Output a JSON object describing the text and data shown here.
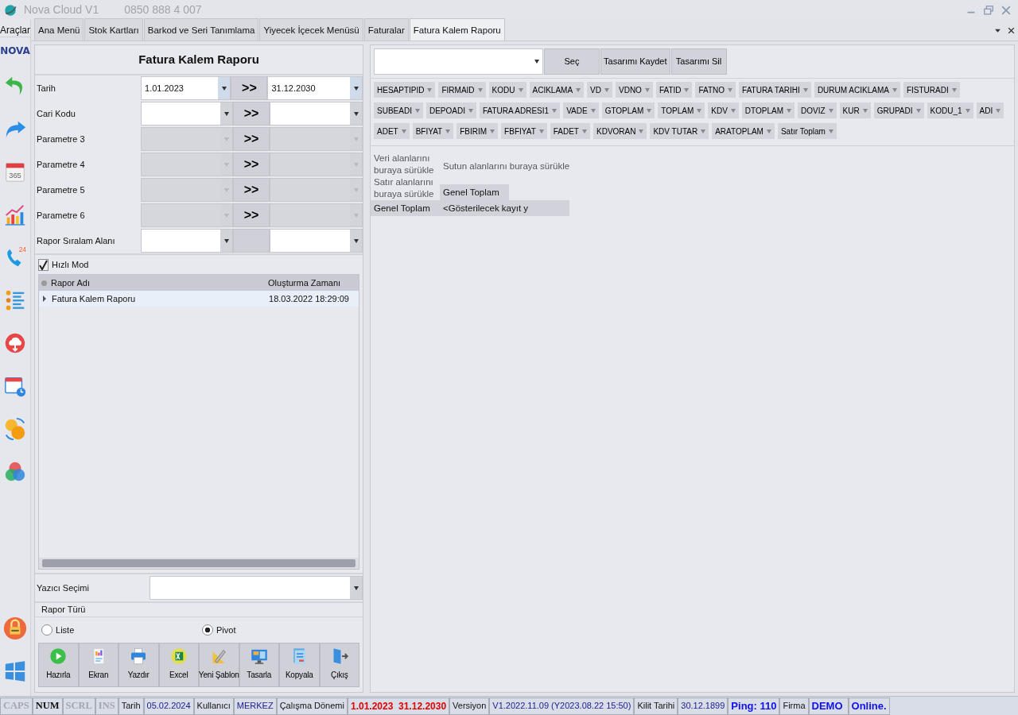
{
  "title_bar": {
    "app_name": "Nova Cloud V1",
    "phone": "0850 888 4 007"
  },
  "sidebar": {
    "label": "Araçlar",
    "logo": "NOVA",
    "items": [
      {
        "kind": "undo"
      },
      {
        "kind": "redo"
      },
      {
        "kind": "calendar",
        "text": "365"
      },
      {
        "kind": "chart"
      },
      {
        "kind": "phone",
        "text": "24"
      },
      {
        "kind": "list"
      },
      {
        "kind": "cloud"
      },
      {
        "kind": "schedule"
      },
      {
        "kind": "coins"
      },
      {
        "kind": "colors"
      }
    ],
    "bottom_items": [
      {
        "kind": "lock"
      },
      {
        "kind": "windows"
      }
    ]
  },
  "tabs": [
    {
      "label": "Ana Menü",
      "selected": false
    },
    {
      "label": "Stok Kartları",
      "selected": false
    },
    {
      "label": "Barkod ve Seri Tanımlama",
      "selected": false
    },
    {
      "label": "Yiyecek İçecek Menüsü",
      "selected": false
    },
    {
      "label": "Faturalar",
      "selected": false
    },
    {
      "label": "Fatura Kalem Raporu",
      "selected": true
    }
  ],
  "report_panel": {
    "title": "Fatura Kalem Raporu",
    "filters": [
      {
        "label": "Tarih",
        "from": "1.01.2023",
        "to": "31.12.2030",
        "arrow": ">>",
        "enabled": true
      },
      {
        "label": "Cari Kodu",
        "arrow": ">>",
        "enabled": true
      },
      {
        "label": "Parametre 3",
        "arrow": ">>",
        "enabled": false
      },
      {
        "label": "Parametre 4",
        "arrow": ">>",
        "enabled": false
      },
      {
        "label": "Parametre 5",
        "arrow": ">>",
        "enabled": false
      },
      {
        "label": "Parametre 6",
        "arrow": ">>",
        "enabled": false
      },
      {
        "label": "Rapor Sıralam Alanı",
        "enabled": true
      }
    ],
    "fast_mode": {
      "label": "Hızlı Mod",
      "checked": true
    },
    "report_list": {
      "columns": [
        "Rapor Adı",
        "Oluşturma Zamanı"
      ],
      "rows": [
        {
          "cells": [
            "Fatura Kalem Raporu",
            "18.03.2022 18:29:09"
          ],
          "selected": true
        }
      ]
    },
    "printer": {
      "label": "Yazıcı Seçimi"
    },
    "report_type": {
      "title": "Rapor Türü",
      "options": [
        {
          "label": "Liste",
          "selected": false
        },
        {
          "label": "Pivot",
          "selected": true
        }
      ]
    },
    "actions": [
      {
        "label": "Hazırla",
        "kind": "run"
      },
      {
        "label": "Ekran",
        "kind": "screen"
      },
      {
        "label": "Yazdır",
        "kind": "print"
      },
      {
        "label": "Excel",
        "kind": "excel"
      },
      {
        "label": "Yeni Şablon",
        "kind": "template"
      },
      {
        "label": "Tasarla",
        "kind": "design"
      },
      {
        "label": "Kopyala",
        "kind": "copy"
      },
      {
        "label": "Çıkış",
        "kind": "exit"
      }
    ]
  },
  "pivot_panel": {
    "toolbar_buttons": [
      "Seç",
      "Tasarımı Kaydet",
      "Tasarımı Sil"
    ],
    "fields": [
      "HESAPTIPID",
      "FIRMAID",
      "KODU",
      "ACIKLAMA",
      "VD",
      "VDNO",
      "FATID",
      "FATNO",
      "FATURA TARIHI",
      "DURUM ACIKLAMA",
      "FISTURADI",
      "SUBEADI",
      "DEPOADI",
      "FATURA ADRESI1",
      "VADE",
      "GTOPLAM",
      "TOPLAM",
      "KDV",
      "DTOPLAM",
      "DOVIZ",
      "KUR",
      "GRUPADI",
      "KODU_1",
      "ADI",
      "ADET",
      "BFIYAT",
      "FBIRIM",
      "FBFIYAT",
      "FADET",
      "KDVORAN",
      "KDV TUTAR",
      "ARATOPLAM",
      "Satır Toplam"
    ],
    "data_hint": "Veri alanlarını buraya sürükle",
    "column_hint": "Sutun alanlarını buraya sürükle",
    "row_hint": "Satır alanlarını buraya sürükle",
    "column_total": "Genel Toplam",
    "row_total": "Genel Toplam",
    "empty_cell": "<Gösterilecek kayıt y"
  },
  "status_bar": {
    "keys": [
      {
        "label": "CAPS",
        "on": false
      },
      {
        "label": "NUM",
        "on": true
      },
      {
        "label": "SCRL",
        "on": false
      },
      {
        "label": "INS",
        "on": false
      }
    ],
    "fields": [
      {
        "kind": "label",
        "text": "Tarih"
      },
      {
        "kind": "value",
        "text": "05.02.2024"
      },
      {
        "kind": "label",
        "text": "Kullanıcı"
      },
      {
        "kind": "value",
        "text": "MERKEZ"
      },
      {
        "kind": "label",
        "text": "Çalışma Dönemi"
      },
      {
        "kind": "alert",
        "text": "1.01.2023  31.12.2030"
      },
      {
        "kind": "label",
        "text": "Versiyon"
      },
      {
        "kind": "value",
        "text": "V1.2022.11.09 (Y2023.08.22 15:50)"
      },
      {
        "kind": "label",
        "text": "Kilit Tarihi"
      },
      {
        "kind": "value",
        "text": "30.12.1899"
      },
      {
        "kind": "emphasis",
        "text": "Ping: 110"
      },
      {
        "kind": "label",
        "text": "Firma"
      },
      {
        "kind": "emphasis",
        "text": "DEMO"
      },
      {
        "kind": "emphasis",
        "text": "Online."
      }
    ]
  }
}
